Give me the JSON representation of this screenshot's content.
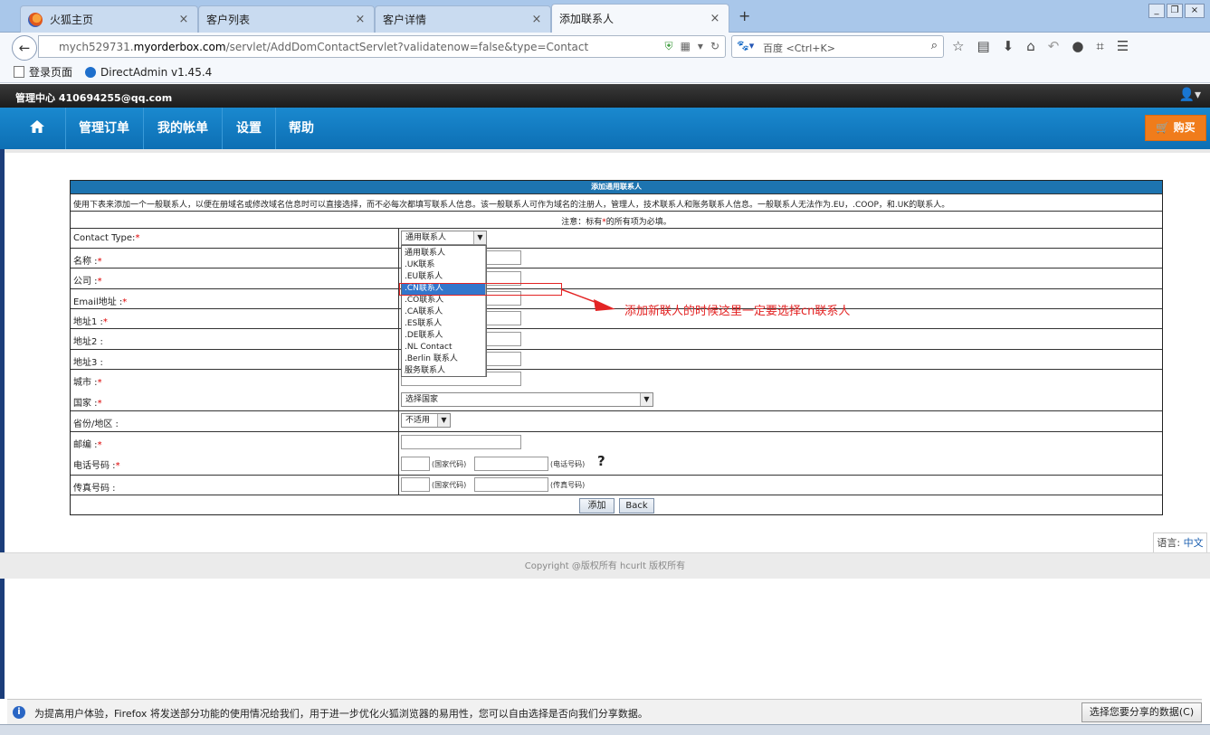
{
  "browser": {
    "tabs": [
      {
        "label": "火狐主页"
      },
      {
        "label": "客户列表"
      },
      {
        "label": "客户详情"
      },
      {
        "label": "添加联系人"
      }
    ],
    "url_prefix": "mych529731.",
    "url_domain": "myorderbox.com",
    "url_path": "/servlet/AddDomContactServlet?validatenow=false&type=Contact",
    "search_engine": "百度",
    "search_placeholder": "<Ctrl+K>",
    "bookmarks": [
      {
        "label": "登录页面"
      },
      {
        "label": "DirectAdmin v1.45.4"
      }
    ]
  },
  "header": {
    "account_text": "管理中心 410694255@qq.com",
    "menu": [
      {
        "label": "管理订单"
      },
      {
        "label": "我的帐单"
      },
      {
        "label": "设置"
      },
      {
        "label": "帮助"
      }
    ],
    "buy_label": "购买"
  },
  "form": {
    "title": "添加通用联系人",
    "description": "使用下表来添加一个一般联系人，以便在册域名或修改域名信息时可以直接选择，而不必每次都填写联系人信息。该一般联系人可作为域名的注册人，管理人，技术联系人和账务联系人信息。一般联系人无法作为.EU，.COOP，和.UK的联系人。",
    "note_prefix": "注意：标有",
    "note_star": "*",
    "note_suffix": "的所有项为必填。",
    "labels": {
      "contact_type": "Contact Type:",
      "name": "名称 :",
      "company": "公司 :",
      "email": "Email地址 :",
      "addr1": "地址1 :",
      "addr2": "地址2 :",
      "addr3": "地址3 :",
      "city": "城市 :",
      "country": "国家 :",
      "state": "省份/地区 :",
      "zip": "邮编 :",
      "phone": "电话号码 :",
      "fax": "传真号码 :"
    },
    "required_mark": "*",
    "contact_type_value": "通用联系人",
    "contact_type_options": [
      "通用联系人",
      ".UK联系",
      ".EU联系人",
      ".CN联系人",
      ".CO联系人",
      ".CA联系人",
      ".ES联系人",
      ".DE联系人",
      ".NL Contact",
      ".Berlin 联系人",
      "服务联系人"
    ],
    "highlighted_option_index": 3,
    "country_value": "选择国家",
    "state_value": "不适用",
    "country_code_hint": "(国家代码)",
    "phone_hint": "(电话号码)",
    "fax_hint": "(传真号码)",
    "help_mark": "?",
    "submit_label": "添加",
    "back_label": "Back"
  },
  "annotation": {
    "text": "添加新联人的时候这里一定要选择cn联系人",
    "color": "#e32424"
  },
  "footer": {
    "language_label": "语言:",
    "language_value": "中文",
    "copyright": "Copyright @版权所有 hcurlt 版权所有"
  },
  "notification": {
    "text": "为提高用户体验，Firefox 将发送部分功能的使用情况给我们，用于进一步优化火狐浏览器的易用性，您可以自由选择是否向我们分享数据。",
    "button_label": "选择您要分享的数据(C)"
  },
  "colors": {
    "nav_blue": "#1a89cf",
    "buy_orange": "#f07c1b",
    "form_title_blue": "#1d74b0",
    "required_red": "#dd0000"
  }
}
